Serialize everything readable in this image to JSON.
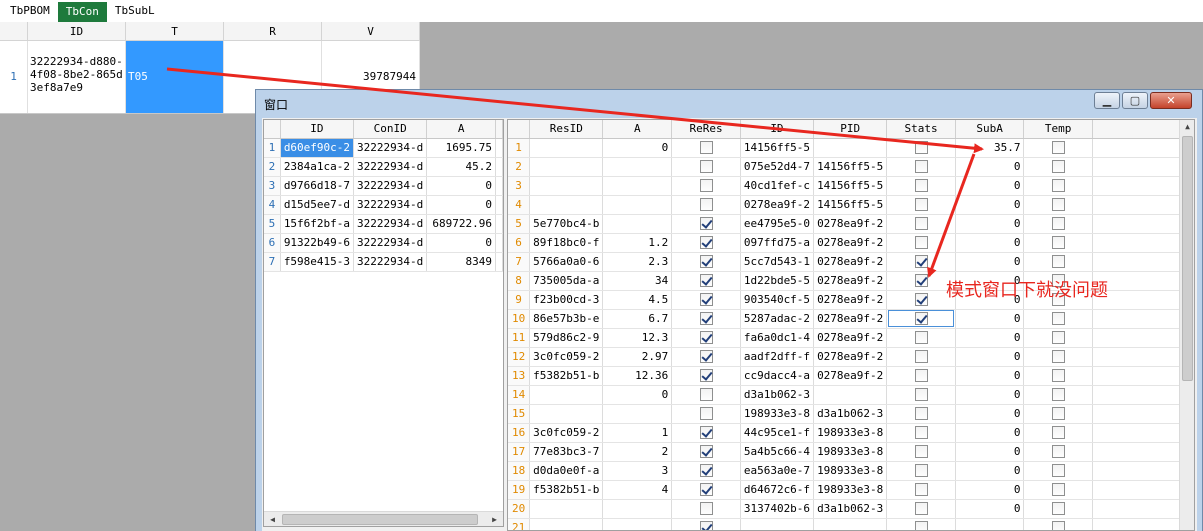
{
  "tabs": [
    {
      "label": "TbPBOM",
      "active": false
    },
    {
      "label": "TbCon",
      "active": true
    },
    {
      "label": "TbSubL",
      "active": false
    }
  ],
  "bg_grid": {
    "headers": [
      "ID",
      "T",
      "R",
      "V"
    ],
    "row": {
      "num": "1",
      "id": "32222934-d880-4f08-8be2-865d3ef8a7e9",
      "t": "T05",
      "r": "",
      "v": "39787944"
    }
  },
  "window": {
    "title": "窗口",
    "min_glyph": "▁",
    "max_glyph": "▢",
    "close_glyph": "✕"
  },
  "left_grid": {
    "headers": [
      "ID",
      "ConID",
      "A"
    ],
    "rows": [
      {
        "num": "1",
        "id": "d60ef90c-2",
        "conid": "32222934-d",
        "a": "1695.75"
      },
      {
        "num": "2",
        "id": "2384a1ca-2",
        "conid": "32222934-d",
        "a": "45.2"
      },
      {
        "num": "3",
        "id": "d9766d18-7",
        "conid": "32222934-d",
        "a": "0"
      },
      {
        "num": "4",
        "id": "d15d5ee7-d",
        "conid": "32222934-d",
        "a": "0"
      },
      {
        "num": "5",
        "id": "15f6f2bf-a",
        "conid": "32222934-d",
        "a": "689722.96"
      },
      {
        "num": "6",
        "id": "91322b49-6",
        "conid": "32222934-d",
        "a": "0"
      },
      {
        "num": "7",
        "id": "f598e415-3",
        "conid": "32222934-d",
        "a": "8349"
      }
    ]
  },
  "right_grid": {
    "headers": [
      "ResID",
      "A",
      "ReRes",
      "ID",
      "PID",
      "Stats",
      "SubA",
      "Temp"
    ],
    "rows": [
      {
        "num": "1",
        "resid": "",
        "a": "0",
        "reres": false,
        "id": "14156ff5-5",
        "pid": "",
        "stats": false,
        "suba": "35.7",
        "temp": false
      },
      {
        "num": "2",
        "resid": "",
        "a": "",
        "reres": false,
        "id": "075e52d4-7",
        "pid": "14156ff5-5",
        "stats": false,
        "suba": "0",
        "temp": false
      },
      {
        "num": "3",
        "resid": "",
        "a": "",
        "reres": false,
        "id": "40cd1fef-c",
        "pid": "14156ff5-5",
        "stats": false,
        "suba": "0",
        "temp": false
      },
      {
        "num": "4",
        "resid": "",
        "a": "",
        "reres": false,
        "id": "0278ea9f-2",
        "pid": "14156ff5-5",
        "stats": false,
        "suba": "0",
        "temp": false
      },
      {
        "num": "5",
        "resid": "5e770bc4-b",
        "a": "",
        "reres": true,
        "id": "ee4795e5-0",
        "pid": "0278ea9f-2",
        "stats": false,
        "suba": "0",
        "temp": false
      },
      {
        "num": "6",
        "resid": "89f18bc0-f",
        "a": "1.2",
        "reres": true,
        "id": "097ffd75-a",
        "pid": "0278ea9f-2",
        "stats": false,
        "suba": "0",
        "temp": false
      },
      {
        "num": "7",
        "resid": "5766a0a0-6",
        "a": "2.3",
        "reres": true,
        "id": "5cc7d543-1",
        "pid": "0278ea9f-2",
        "stats": true,
        "suba": "0",
        "temp": false
      },
      {
        "num": "8",
        "resid": "735005da-a",
        "a": "34",
        "reres": true,
        "id": "1d22bde5-5",
        "pid": "0278ea9f-2",
        "stats": true,
        "suba": "0",
        "temp": false
      },
      {
        "num": "9",
        "resid": "f23b00cd-3",
        "a": "4.5",
        "reres": true,
        "id": "903540cf-5",
        "pid": "0278ea9f-2",
        "stats": true,
        "suba": "0",
        "temp": false
      },
      {
        "num": "10",
        "resid": "86e57b3b-e",
        "a": "6.7",
        "reres": true,
        "id": "5287adac-2",
        "pid": "0278ea9f-2",
        "stats": true,
        "suba": "0",
        "temp": false
      },
      {
        "num": "11",
        "resid": "579d86c2-9",
        "a": "12.3",
        "reres": true,
        "id": "fa6a0dc1-4",
        "pid": "0278ea9f-2",
        "stats": false,
        "suba": "0",
        "temp": false
      },
      {
        "num": "12",
        "resid": "3c0fc059-2",
        "a": "2.97",
        "reres": true,
        "id": "aadf2dff-f",
        "pid": "0278ea9f-2",
        "stats": false,
        "suba": "0",
        "temp": false
      },
      {
        "num": "13",
        "resid": "f5382b51-b",
        "a": "12.36",
        "reres": true,
        "id": "cc9dacc4-a",
        "pid": "0278ea9f-2",
        "stats": false,
        "suba": "0",
        "temp": false
      },
      {
        "num": "14",
        "resid": "",
        "a": "0",
        "reres": false,
        "id": "d3a1b062-3",
        "pid": "",
        "stats": false,
        "suba": "0",
        "temp": false
      },
      {
        "num": "15",
        "resid": "",
        "a": "",
        "reres": false,
        "id": "198933e3-8",
        "pid": "d3a1b062-3",
        "stats": false,
        "suba": "0",
        "temp": false
      },
      {
        "num": "16",
        "resid": "3c0fc059-2",
        "a": "1",
        "reres": true,
        "id": "44c95ce1-f",
        "pid": "198933e3-8",
        "stats": false,
        "suba": "0",
        "temp": false
      },
      {
        "num": "17",
        "resid": "77e83bc3-7",
        "a": "2",
        "reres": true,
        "id": "5a4b5c66-4",
        "pid": "198933e3-8",
        "stats": false,
        "suba": "0",
        "temp": false
      },
      {
        "num": "18",
        "resid": "d0da0e0f-a",
        "a": "3",
        "reres": true,
        "id": "ea563a0e-7",
        "pid": "198933e3-8",
        "stats": false,
        "suba": "0",
        "temp": false
      },
      {
        "num": "19",
        "resid": "f5382b51-b",
        "a": "4",
        "reres": true,
        "id": "d64672c6-f",
        "pid": "198933e3-8",
        "stats": false,
        "suba": "0",
        "temp": false
      },
      {
        "num": "20",
        "resid": "",
        "a": "",
        "reres": false,
        "id": "3137402b-6",
        "pid": "d3a1b062-3",
        "stats": false,
        "suba": "0",
        "temp": false
      },
      {
        "num": "21",
        "resid": "",
        "a": "",
        "reres": true,
        "id": "",
        "pid": "",
        "stats": false,
        "suba": "",
        "temp": false
      }
    ]
  },
  "annotation": {
    "text": "模式窗口下就没问题",
    "color": "#e8271f"
  }
}
